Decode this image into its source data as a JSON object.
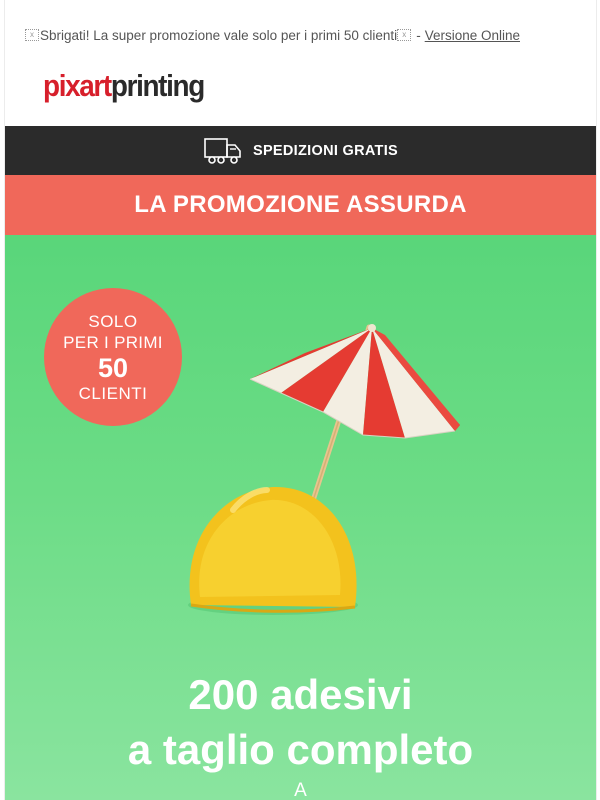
{
  "preheader": {
    "text": "Sbrigati! La super promozione vale solo per i primi 50 clienti",
    "separator": "-",
    "online_link": "Versione Online"
  },
  "logo": {
    "part1": "pixart",
    "part2": "printing"
  },
  "shipping_bar": {
    "label": "SPEDIZIONI GRATIS",
    "icon": "truck-icon"
  },
  "promo_bar": {
    "label": "LA PROMOZIONE ASSURDA"
  },
  "badge": {
    "line1": "SOLO",
    "line2": "PER I PRIMI",
    "number": "50",
    "line4": "CLIENTI"
  },
  "hero": {
    "headline_line1": "200 adesivi",
    "headline_line2": "a taglio completo",
    "sub": "A"
  },
  "colors": {
    "brand_red": "#d71f2b",
    "promo_red": "#f0685a",
    "dark_bar": "#2b2b2b",
    "hero_green": "#59d67a"
  }
}
